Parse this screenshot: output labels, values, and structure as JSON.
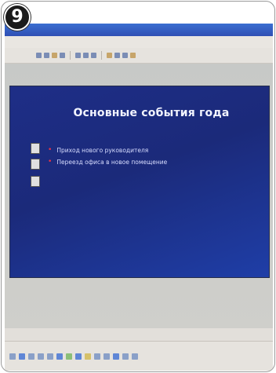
{
  "badge": {
    "number": "9"
  },
  "slide": {
    "title": "Основные события года",
    "bullets": [
      "Приход нового руководителя",
      "Переезд офиса в новое помещение"
    ]
  },
  "colors": {
    "slide_background": "#1e2e87",
    "slide_title": "#f2f4ff",
    "bullet_text": "#d7dcff",
    "bullet_marker": "#e33344",
    "titlebar": "#2f4fb4"
  },
  "icons": [
    "drawing-toolbar-icon",
    "formatting-toolbar-icon"
  ]
}
